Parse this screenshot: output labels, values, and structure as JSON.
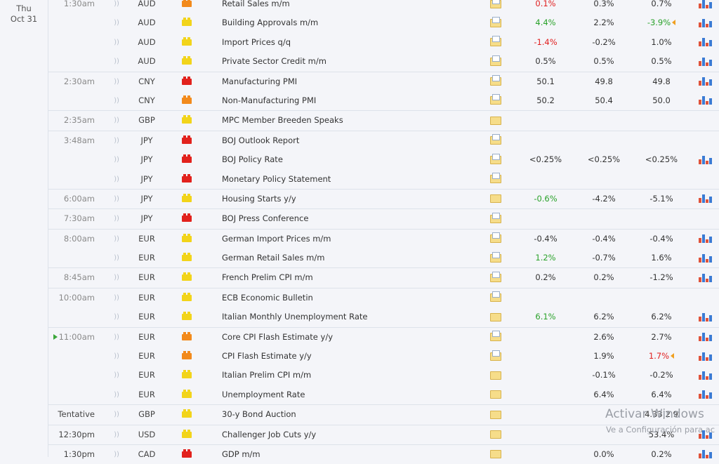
{
  "date": {
    "weekday": "Thu",
    "day": "Oct 31"
  },
  "rows": [
    {
      "time": "1:30am",
      "group": true,
      "currency": "AUD",
      "impact": "med",
      "event": "Retail Sales m/m",
      "actual": "0.1%",
      "actual_color": "red",
      "forecast": "0.3%",
      "previous": "0.7%",
      "chart": true
    },
    {
      "time": "",
      "currency": "AUD",
      "impact": "low",
      "event": "Building Approvals m/m",
      "actual": "4.4%",
      "actual_color": "green",
      "forecast": "2.2%",
      "previous": "-3.9%",
      "previous_color": "green",
      "revised": true,
      "chart": true
    },
    {
      "time": "",
      "currency": "AUD",
      "impact": "low",
      "event": "Import Prices q/q",
      "actual": "-1.4%",
      "actual_color": "red",
      "forecast": "-0.2%",
      "previous": "1.0%",
      "chart": true
    },
    {
      "time": "",
      "currency": "AUD",
      "impact": "low",
      "event": "Private Sector Credit m/m",
      "actual": "0.5%",
      "actual_color": "black",
      "forecast": "0.5%",
      "previous": "0.5%",
      "chart": true
    },
    {
      "time": "2:30am",
      "group": true,
      "currency": "CNY",
      "impact": "high",
      "event": "Manufacturing PMI",
      "actual": "50.1",
      "actual_color": "black",
      "forecast": "49.8",
      "previous": "49.8",
      "chart": true
    },
    {
      "time": "",
      "currency": "CNY",
      "impact": "med",
      "event": "Non-Manufacturing PMI",
      "actual": "50.2",
      "actual_color": "black",
      "forecast": "50.4",
      "previous": "50.0",
      "chart": true
    },
    {
      "time": "2:35am",
      "group": true,
      "currency": "GBP",
      "impact": "low",
      "event": "MPC Member Breeden Speaks",
      "actual": "",
      "forecast": "",
      "previous": "",
      "folder": "plain",
      "chart": false
    },
    {
      "time": "3:48am",
      "group": true,
      "currency": "JPY",
      "impact": "high",
      "event": "BOJ Outlook Report",
      "actual": "",
      "forecast": "",
      "previous": "",
      "chart": false
    },
    {
      "time": "",
      "currency": "JPY",
      "impact": "high",
      "event": "BOJ Policy Rate",
      "actual": "<0.25%",
      "actual_color": "black",
      "forecast": "<0.25%",
      "previous": "<0.25%",
      "chart": true
    },
    {
      "time": "",
      "currency": "JPY",
      "impact": "high",
      "event": "Monetary Policy Statement",
      "actual": "",
      "forecast": "",
      "previous": "",
      "chart": false
    },
    {
      "time": "6:00am",
      "group": true,
      "currency": "JPY",
      "impact": "low",
      "event": "Housing Starts y/y",
      "actual": "-0.6%",
      "actual_color": "green",
      "forecast": "-4.2%",
      "previous": "-5.1%",
      "folder": "plain",
      "chart": true
    },
    {
      "time": "7:30am",
      "group": true,
      "currency": "JPY",
      "impact": "high",
      "event": "BOJ Press Conference",
      "actual": "",
      "forecast": "",
      "previous": "",
      "chart": false
    },
    {
      "time": "8:00am",
      "group": true,
      "currency": "EUR",
      "impact": "low",
      "event": "German Import Prices m/m",
      "actual": "-0.4%",
      "actual_color": "black",
      "forecast": "-0.4%",
      "previous": "-0.4%",
      "chart": true
    },
    {
      "time": "",
      "currency": "EUR",
      "impact": "low",
      "event": "German Retail Sales m/m",
      "actual": "1.2%",
      "actual_color": "green",
      "forecast": "-0.7%",
      "previous": "1.6%",
      "chart": true
    },
    {
      "time": "8:45am",
      "group": true,
      "currency": "EUR",
      "impact": "low",
      "event": "French Prelim CPI m/m",
      "actual": "0.2%",
      "actual_color": "black",
      "forecast": "0.2%",
      "previous": "-1.2%",
      "chart": true
    },
    {
      "time": "10:00am",
      "group": true,
      "currency": "EUR",
      "impact": "low",
      "event": "ECB Economic Bulletin",
      "actual": "",
      "forecast": "",
      "previous": "",
      "chart": false
    },
    {
      "time": "",
      "currency": "EUR",
      "impact": "low",
      "event": "Italian Monthly Unemployment Rate",
      "actual": "6.1%",
      "actual_color": "green",
      "forecast": "6.2%",
      "previous": "6.2%",
      "folder": "plain",
      "chart": true
    },
    {
      "time": "11:00am",
      "group": true,
      "upcoming": true,
      "currency": "EUR",
      "impact": "med",
      "event": "Core CPI Flash Estimate y/y",
      "actual": "",
      "forecast": "2.6%",
      "previous": "2.7%",
      "chart": true
    },
    {
      "time": "",
      "currency": "EUR",
      "impact": "med",
      "event": "CPI Flash Estimate y/y",
      "actual": "",
      "forecast": "1.9%",
      "previous": "1.7%",
      "previous_color": "red",
      "revised": true,
      "chart": true
    },
    {
      "time": "",
      "currency": "EUR",
      "impact": "low",
      "event": "Italian Prelim CPI m/m",
      "actual": "",
      "forecast": "-0.1%",
      "previous": "-0.2%",
      "folder": "plain",
      "chart": true
    },
    {
      "time": "",
      "currency": "EUR",
      "impact": "low",
      "event": "Unemployment Rate",
      "actual": "",
      "forecast": "6.4%",
      "previous": "6.4%",
      "folder": "plain",
      "chart": true
    },
    {
      "time": "Tentative",
      "group": true,
      "dark": true,
      "currency": "GBP",
      "impact": "low",
      "event": "30-y Bond Auction",
      "actual": "",
      "forecast": "",
      "previous": "4.33|2.9",
      "folder": "plain",
      "chart": false
    },
    {
      "time": "12:30pm",
      "group": true,
      "dark": true,
      "currency": "USD",
      "impact": "low",
      "event": "Challenger Job Cuts y/y",
      "actual": "",
      "forecast": "",
      "previous": "53.4%",
      "folder": "plain",
      "chart": true
    },
    {
      "time": "1:30pm",
      "group": true,
      "dark": true,
      "currency": "CAD",
      "impact": "high",
      "event": "GDP m/m",
      "actual": "",
      "forecast": "0.0%",
      "previous": "0.2%",
      "folder": "plain",
      "chart": true
    }
  ],
  "watermark": {
    "title": "Activar Windows",
    "subtitle": "Ve a Configuración para ac"
  },
  "colors": {
    "green": "#2aa22a",
    "red": "#e02020",
    "high": "#e2221d",
    "medium": "#f28a1c",
    "low": "#f2d41a"
  }
}
